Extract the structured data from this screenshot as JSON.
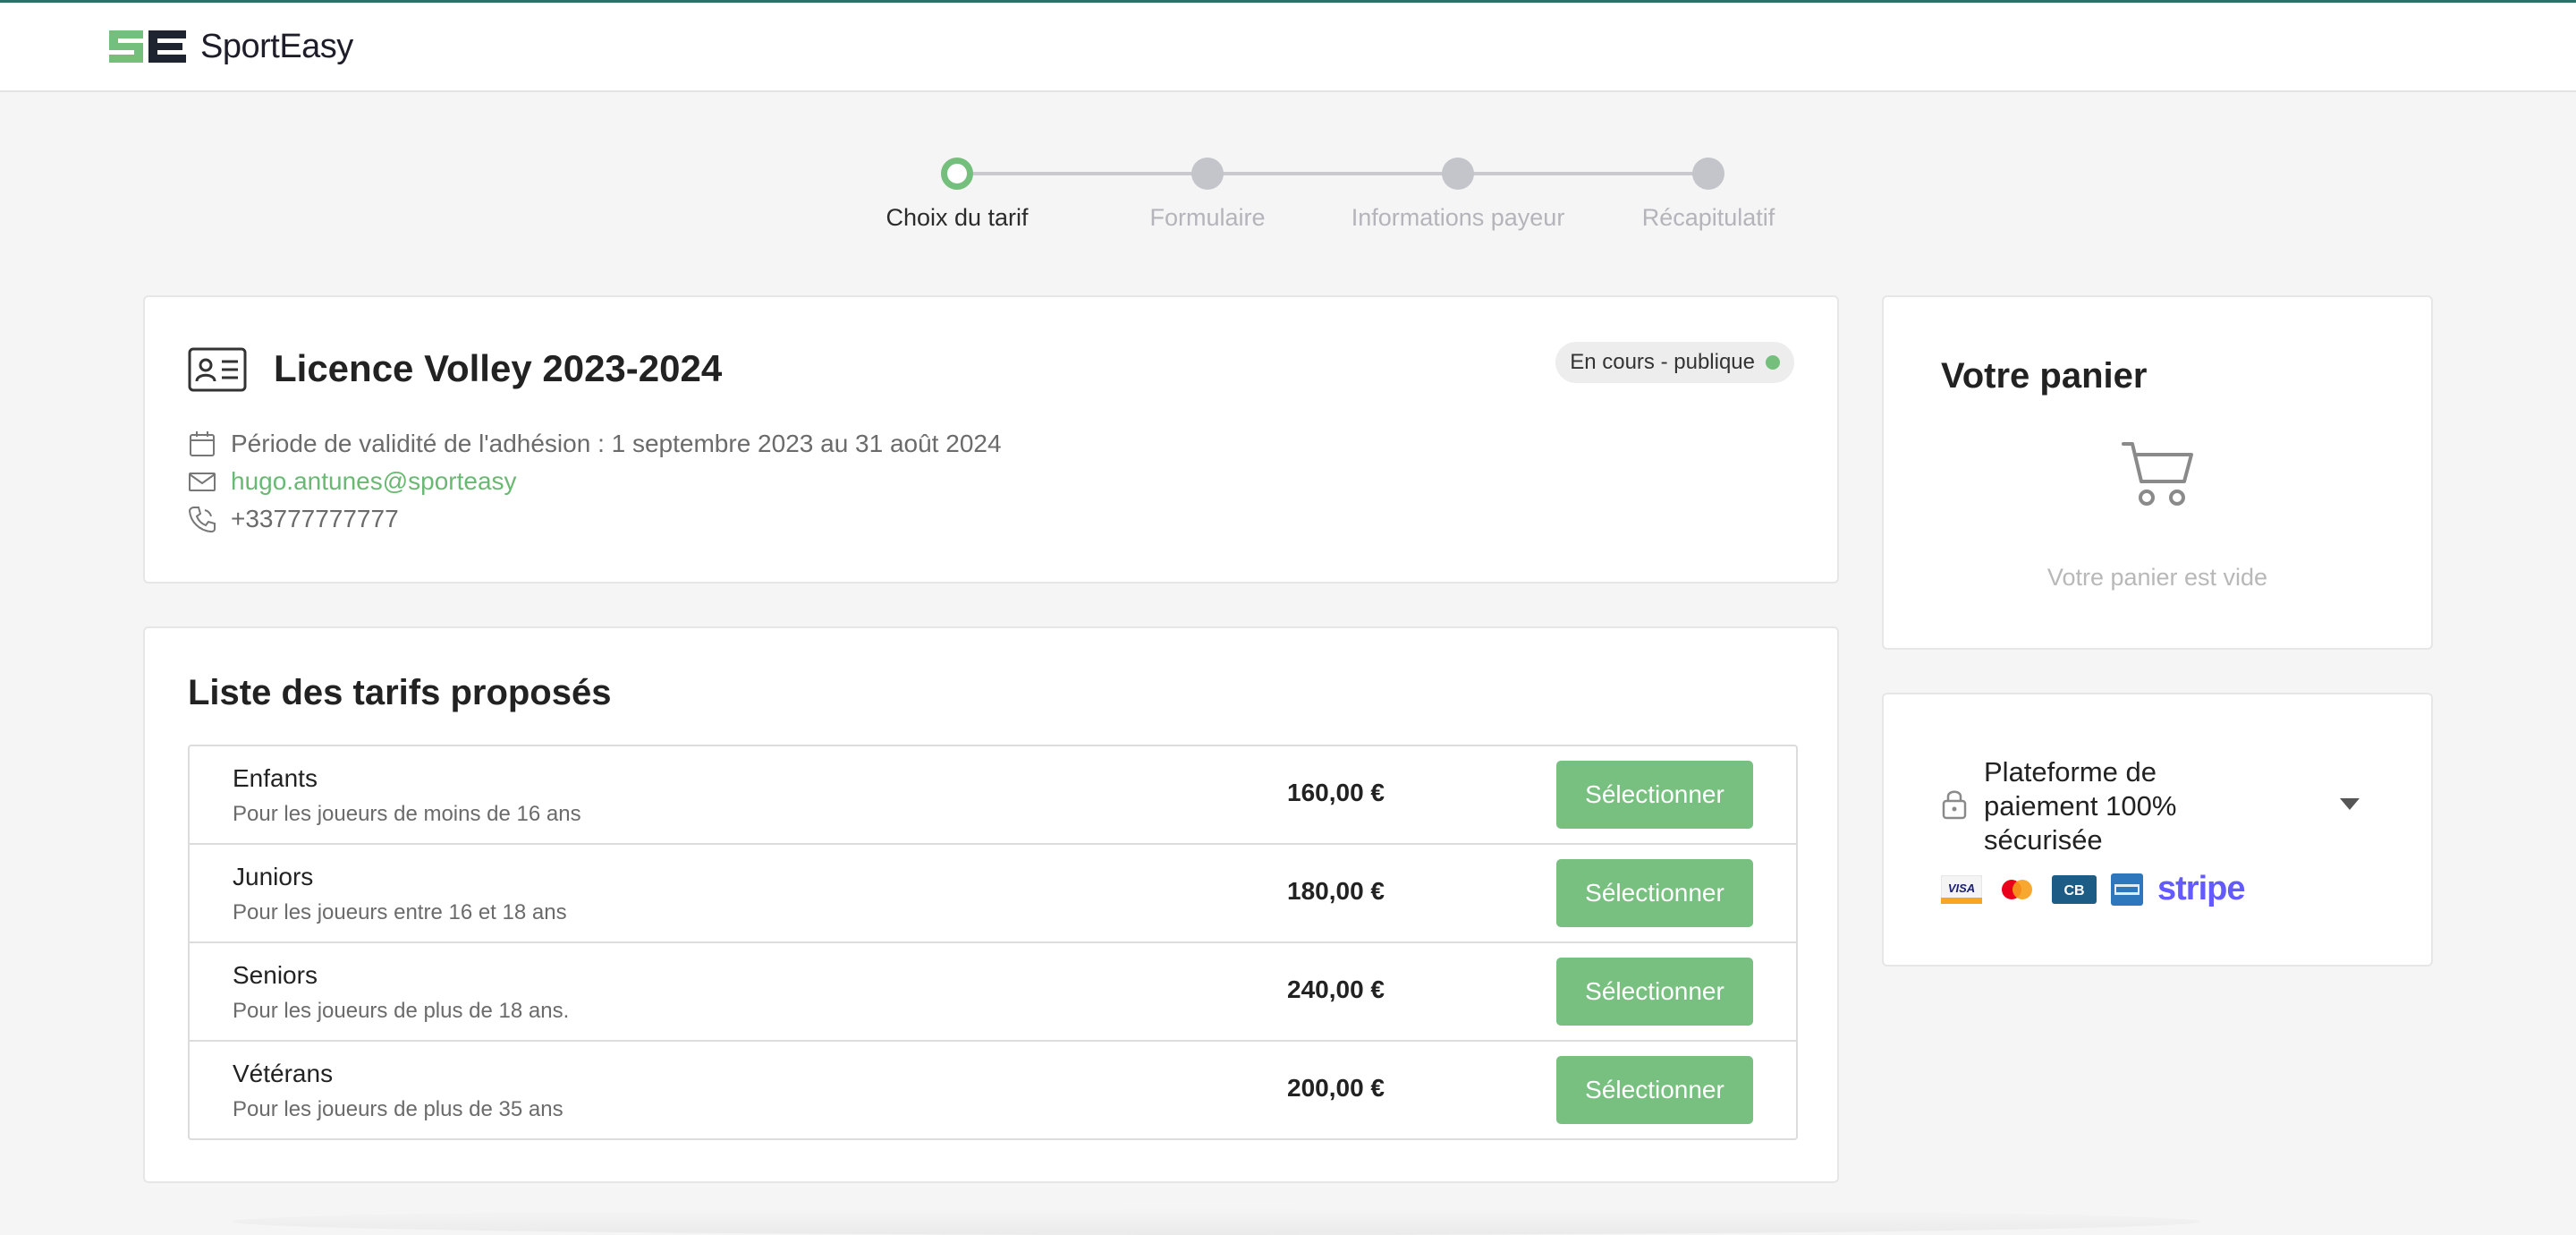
{
  "brand": {
    "name": "SportEasy",
    "mark": "SE",
    "mark_colors": [
      "#74bf7c",
      "#1e2530"
    ]
  },
  "stepper": {
    "steps": [
      {
        "label": "Choix du tarif",
        "active": true
      },
      {
        "label": "Formulaire",
        "active": false
      },
      {
        "label": "Informations payeur",
        "active": false
      },
      {
        "label": "Récapitulatif",
        "active": false
      }
    ]
  },
  "license": {
    "title": "Licence Volley 2023-2024",
    "status": "En cours - publique",
    "validity": "Période de validité de l'adhésion : 1 septembre 2023 au 31 août 2024",
    "email": "hugo.antunes@sporteasy",
    "phone": "+33777777777"
  },
  "tariffs": {
    "title": "Liste des tarifs proposés",
    "button_label": "Sélectionner",
    "rows": [
      {
        "name": "Enfants",
        "desc": "Pour les joueurs de moins de 16 ans",
        "price": "160,00 €"
      },
      {
        "name": "Juniors",
        "desc": "Pour les joueurs entre 16 et 18 ans",
        "price": "180,00 €"
      },
      {
        "name": "Seniors",
        "desc": "Pour les joueurs de plus de 18 ans.",
        "price": "240,00 €"
      },
      {
        "name": "Vétérans",
        "desc": "Pour les joueurs de plus de 35 ans",
        "price": "200,00 €"
      }
    ]
  },
  "cart": {
    "title": "Votre panier",
    "empty_text": "Votre panier est vide"
  },
  "payment": {
    "text": "Plateforme de paiement 100% sécurisée",
    "card_logos": [
      "visa-icon",
      "mastercard-icon",
      "cb-icon",
      "amex-icon"
    ],
    "stripe_label": "stripe"
  },
  "colors": {
    "accent": "#78c07f",
    "link": "#6bb874",
    "stripe": "#635bff"
  }
}
